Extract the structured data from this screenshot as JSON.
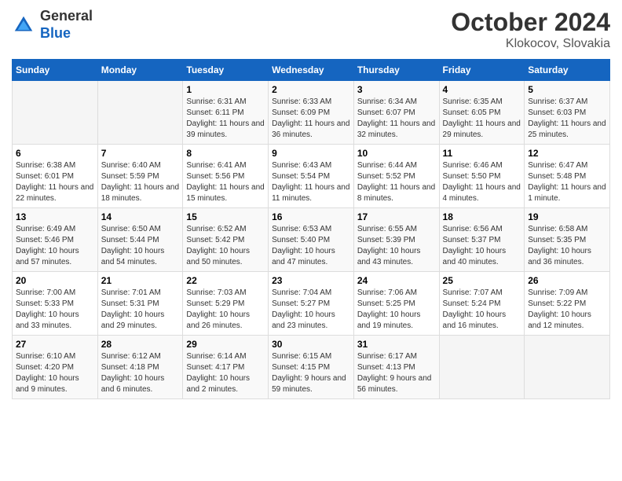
{
  "header": {
    "logo_line1": "General",
    "logo_line2": "Blue",
    "month_year": "October 2024",
    "location": "Klokocov, Slovakia"
  },
  "weekdays": [
    "Sunday",
    "Monday",
    "Tuesday",
    "Wednesday",
    "Thursday",
    "Friday",
    "Saturday"
  ],
  "weeks": [
    [
      {
        "day": "",
        "sunrise": "",
        "sunset": "",
        "daylight": ""
      },
      {
        "day": "",
        "sunrise": "",
        "sunset": "",
        "daylight": ""
      },
      {
        "day": "1",
        "sunrise": "Sunrise: 6:31 AM",
        "sunset": "Sunset: 6:11 PM",
        "daylight": "Daylight: 11 hours and 39 minutes."
      },
      {
        "day": "2",
        "sunrise": "Sunrise: 6:33 AM",
        "sunset": "Sunset: 6:09 PM",
        "daylight": "Daylight: 11 hours and 36 minutes."
      },
      {
        "day": "3",
        "sunrise": "Sunrise: 6:34 AM",
        "sunset": "Sunset: 6:07 PM",
        "daylight": "Daylight: 11 hours and 32 minutes."
      },
      {
        "day": "4",
        "sunrise": "Sunrise: 6:35 AM",
        "sunset": "Sunset: 6:05 PM",
        "daylight": "Daylight: 11 hours and 29 minutes."
      },
      {
        "day": "5",
        "sunrise": "Sunrise: 6:37 AM",
        "sunset": "Sunset: 6:03 PM",
        "daylight": "Daylight: 11 hours and 25 minutes."
      }
    ],
    [
      {
        "day": "6",
        "sunrise": "Sunrise: 6:38 AM",
        "sunset": "Sunset: 6:01 PM",
        "daylight": "Daylight: 11 hours and 22 minutes."
      },
      {
        "day": "7",
        "sunrise": "Sunrise: 6:40 AM",
        "sunset": "Sunset: 5:59 PM",
        "daylight": "Daylight: 11 hours and 18 minutes."
      },
      {
        "day": "8",
        "sunrise": "Sunrise: 6:41 AM",
        "sunset": "Sunset: 5:56 PM",
        "daylight": "Daylight: 11 hours and 15 minutes."
      },
      {
        "day": "9",
        "sunrise": "Sunrise: 6:43 AM",
        "sunset": "Sunset: 5:54 PM",
        "daylight": "Daylight: 11 hours and 11 minutes."
      },
      {
        "day": "10",
        "sunrise": "Sunrise: 6:44 AM",
        "sunset": "Sunset: 5:52 PM",
        "daylight": "Daylight: 11 hours and 8 minutes."
      },
      {
        "day": "11",
        "sunrise": "Sunrise: 6:46 AM",
        "sunset": "Sunset: 5:50 PM",
        "daylight": "Daylight: 11 hours and 4 minutes."
      },
      {
        "day": "12",
        "sunrise": "Sunrise: 6:47 AM",
        "sunset": "Sunset: 5:48 PM",
        "daylight": "Daylight: 11 hours and 1 minute."
      }
    ],
    [
      {
        "day": "13",
        "sunrise": "Sunrise: 6:49 AM",
        "sunset": "Sunset: 5:46 PM",
        "daylight": "Daylight: 10 hours and 57 minutes."
      },
      {
        "day": "14",
        "sunrise": "Sunrise: 6:50 AM",
        "sunset": "Sunset: 5:44 PM",
        "daylight": "Daylight: 10 hours and 54 minutes."
      },
      {
        "day": "15",
        "sunrise": "Sunrise: 6:52 AM",
        "sunset": "Sunset: 5:42 PM",
        "daylight": "Daylight: 10 hours and 50 minutes."
      },
      {
        "day": "16",
        "sunrise": "Sunrise: 6:53 AM",
        "sunset": "Sunset: 5:40 PM",
        "daylight": "Daylight: 10 hours and 47 minutes."
      },
      {
        "day": "17",
        "sunrise": "Sunrise: 6:55 AM",
        "sunset": "Sunset: 5:39 PM",
        "daylight": "Daylight: 10 hours and 43 minutes."
      },
      {
        "day": "18",
        "sunrise": "Sunrise: 6:56 AM",
        "sunset": "Sunset: 5:37 PM",
        "daylight": "Daylight: 10 hours and 40 minutes."
      },
      {
        "day": "19",
        "sunrise": "Sunrise: 6:58 AM",
        "sunset": "Sunset: 5:35 PM",
        "daylight": "Daylight: 10 hours and 36 minutes."
      }
    ],
    [
      {
        "day": "20",
        "sunrise": "Sunrise: 7:00 AM",
        "sunset": "Sunset: 5:33 PM",
        "daylight": "Daylight: 10 hours and 33 minutes."
      },
      {
        "day": "21",
        "sunrise": "Sunrise: 7:01 AM",
        "sunset": "Sunset: 5:31 PM",
        "daylight": "Daylight: 10 hours and 29 minutes."
      },
      {
        "day": "22",
        "sunrise": "Sunrise: 7:03 AM",
        "sunset": "Sunset: 5:29 PM",
        "daylight": "Daylight: 10 hours and 26 minutes."
      },
      {
        "day": "23",
        "sunrise": "Sunrise: 7:04 AM",
        "sunset": "Sunset: 5:27 PM",
        "daylight": "Daylight: 10 hours and 23 minutes."
      },
      {
        "day": "24",
        "sunrise": "Sunrise: 7:06 AM",
        "sunset": "Sunset: 5:25 PM",
        "daylight": "Daylight: 10 hours and 19 minutes."
      },
      {
        "day": "25",
        "sunrise": "Sunrise: 7:07 AM",
        "sunset": "Sunset: 5:24 PM",
        "daylight": "Daylight: 10 hours and 16 minutes."
      },
      {
        "day": "26",
        "sunrise": "Sunrise: 7:09 AM",
        "sunset": "Sunset: 5:22 PM",
        "daylight": "Daylight: 10 hours and 12 minutes."
      }
    ],
    [
      {
        "day": "27",
        "sunrise": "Sunrise: 6:10 AM",
        "sunset": "Sunset: 4:20 PM",
        "daylight": "Daylight: 10 hours and 9 minutes."
      },
      {
        "day": "28",
        "sunrise": "Sunrise: 6:12 AM",
        "sunset": "Sunset: 4:18 PM",
        "daylight": "Daylight: 10 hours and 6 minutes."
      },
      {
        "day": "29",
        "sunrise": "Sunrise: 6:14 AM",
        "sunset": "Sunset: 4:17 PM",
        "daylight": "Daylight: 10 hours and 2 minutes."
      },
      {
        "day": "30",
        "sunrise": "Sunrise: 6:15 AM",
        "sunset": "Sunset: 4:15 PM",
        "daylight": "Daylight: 9 hours and 59 minutes."
      },
      {
        "day": "31",
        "sunrise": "Sunrise: 6:17 AM",
        "sunset": "Sunset: 4:13 PM",
        "daylight": "Daylight: 9 hours and 56 minutes."
      },
      {
        "day": "",
        "sunrise": "",
        "sunset": "",
        "daylight": ""
      },
      {
        "day": "",
        "sunrise": "",
        "sunset": "",
        "daylight": ""
      }
    ]
  ]
}
